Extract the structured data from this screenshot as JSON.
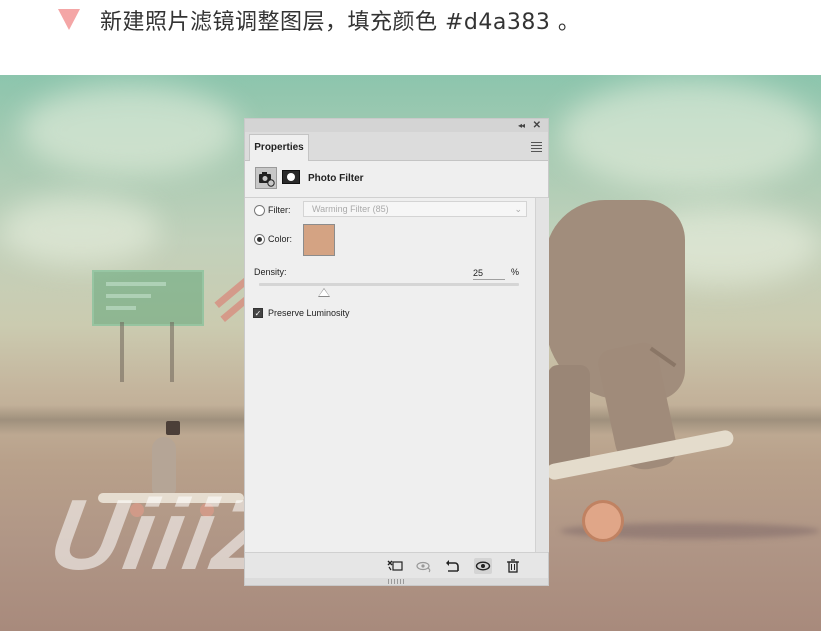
{
  "header": {
    "instruction": "新建照片滤镜调整图层，填充颜色 #d4a383 。"
  },
  "panel": {
    "tab_label": "Properties",
    "collapse_glyph": "◂◂",
    "close_glyph": "✕",
    "adjustment_title": "Photo Filter",
    "filter": {
      "label": "Filter:",
      "value": "Warming Filter (85)",
      "selected": false
    },
    "color": {
      "label": "Color:",
      "hex": "#d4a383",
      "selected": true
    },
    "density": {
      "label": "Density:",
      "value": "25",
      "unit": "%",
      "percent": 25
    },
    "preserve_luminosity": {
      "label": "Preserve Luminosity",
      "checked": true
    },
    "bottom_tools": [
      {
        "name": "clip-to-layer-icon",
        "glyph": "⬚"
      },
      {
        "name": "view-previous-icon",
        "glyph": "◉"
      },
      {
        "name": "reset-icon",
        "glyph": "↺"
      },
      {
        "name": "visibility-eye-icon",
        "glyph": "👁"
      },
      {
        "name": "trash-icon",
        "glyph": "🗑"
      }
    ]
  },
  "watermark": {
    "text": "UiiiZ"
  }
}
